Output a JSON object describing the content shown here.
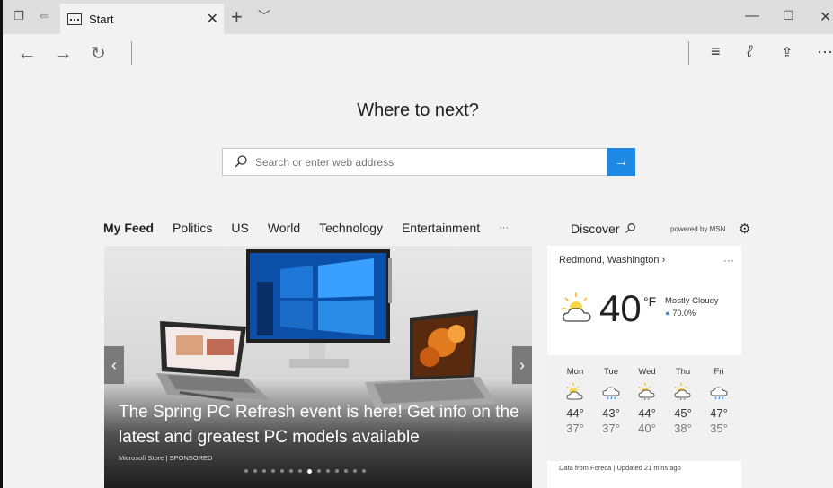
{
  "tab": {
    "title": "Start"
  },
  "content": {
    "heading": "Where to next?",
    "search": {
      "placeholder": "Search or enter web address"
    }
  },
  "feed": {
    "tabs": [
      "My Feed",
      "Politics",
      "US",
      "World",
      "Technology",
      "Entertainment",
      "···"
    ],
    "discover_label": "Discover",
    "powered_by": "powered by MSN"
  },
  "hero": {
    "title": "The Spring PC Refresh event is here! Get info on the latest and greatest PC models available",
    "source": "Microsoft Store | SPONSORED",
    "slide_count": 14,
    "active_slide": 7
  },
  "weather": {
    "location": "Redmond, Washington",
    "more": "···",
    "temperature": "40",
    "unit": "°F",
    "condition": "Mostly Cloudy",
    "precip": "70.0%",
    "forecast": [
      {
        "day": "Mon",
        "icon": "partly-sunny-icon",
        "hi": "44°",
        "lo": "37°"
      },
      {
        "day": "Tue",
        "icon": "rain-icon",
        "hi": "43°",
        "lo": "37°"
      },
      {
        "day": "Wed",
        "icon": "sun-rain-icon",
        "hi": "44°",
        "lo": "40°"
      },
      {
        "day": "Thu",
        "icon": "sun-rain-icon",
        "hi": "45°",
        "lo": "38°"
      },
      {
        "day": "Fri",
        "icon": "rain-icon",
        "hi": "47°",
        "lo": "35°"
      }
    ],
    "footer": "Data from Foreca | Updated 21 mins ago"
  },
  "colors": {
    "accent": "#1e88e5",
    "chrome": "#dedede",
    "page": "#f2f2f2"
  }
}
